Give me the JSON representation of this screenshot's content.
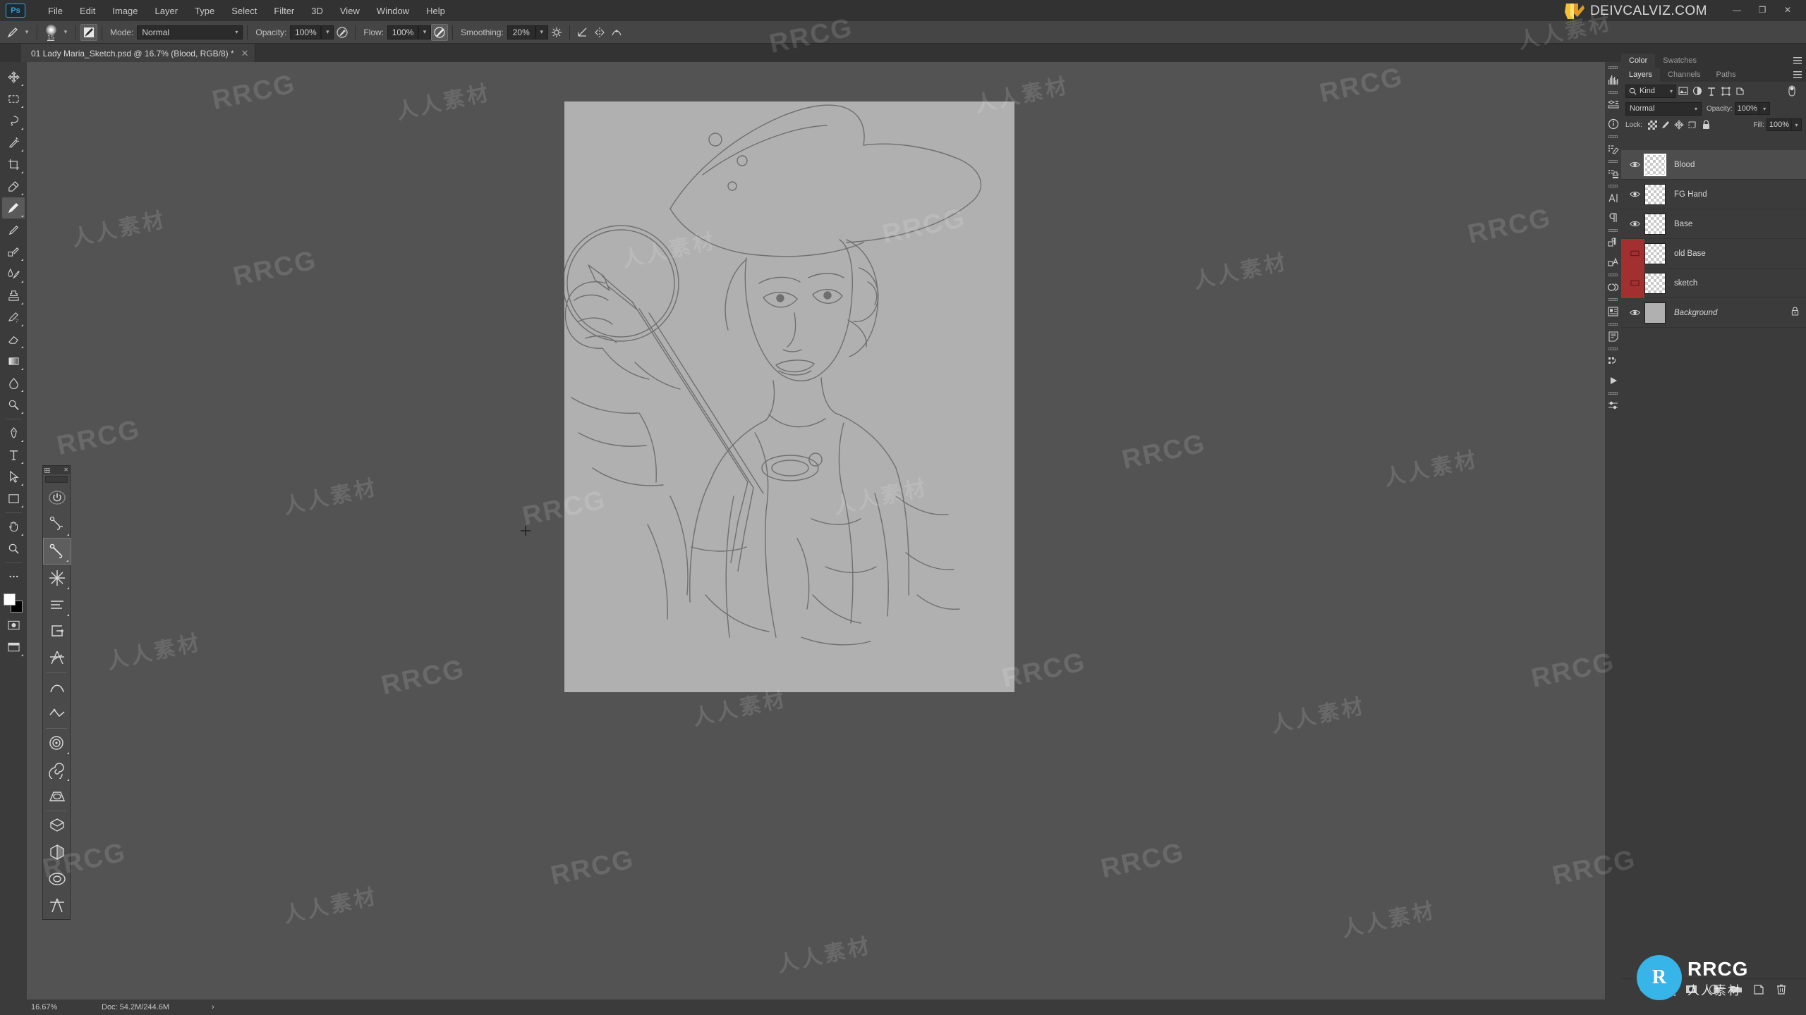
{
  "menubar": {
    "logo": "Ps",
    "items": [
      "File",
      "Edit",
      "Image",
      "Layer",
      "Type",
      "Select",
      "Filter",
      "3D",
      "View",
      "Window",
      "Help"
    ]
  },
  "brand": {
    "text": "DEIVCALVIZ.COM"
  },
  "window_controls": {
    "minimize": "—",
    "restore": "❐",
    "close": "✕"
  },
  "options_bar": {
    "brush_size": "15",
    "mode_label": "Mode:",
    "mode_value": "Normal",
    "opacity_label": "Opacity:",
    "opacity_value": "100%",
    "flow_label": "Flow:",
    "flow_value": "100%",
    "smoothing_label": "Smoothing:",
    "smoothing_value": "20%"
  },
  "document_tab": {
    "title": "01 Lady Maria_Sketch.psd @ 16.7% (Blood, RGB/8) *",
    "close": "✕"
  },
  "toolbar": {
    "tools": [
      {
        "name": "move-tool",
        "active": false
      },
      {
        "name": "marquee-tool",
        "active": false
      },
      {
        "name": "lasso-tool",
        "active": false
      },
      {
        "name": "magic-wand-tool",
        "active": false
      },
      {
        "name": "crop-tool",
        "active": false
      },
      {
        "name": "eyedropper-tool",
        "active": false
      },
      {
        "name": "brush-tool",
        "active": true
      },
      {
        "name": "pencil-tool",
        "active": false
      },
      {
        "name": "clone-stamp-tool",
        "active": false
      },
      {
        "name": "mixer-brush-tool",
        "active": false
      },
      {
        "name": "stamp-tool",
        "active": false
      },
      {
        "name": "history-brush-tool",
        "active": false
      },
      {
        "name": "eraser-tool",
        "active": false
      },
      {
        "name": "gradient-tool",
        "active": false
      },
      {
        "name": "blur-tool",
        "active": false
      },
      {
        "name": "dodge-tool",
        "active": false
      },
      {
        "name": "pen-tool",
        "active": false
      },
      {
        "name": "type-tool",
        "active": false
      },
      {
        "name": "path-select-tool",
        "active": false
      },
      {
        "name": "shape-tool",
        "active": false
      },
      {
        "name": "hand-tool",
        "active": false
      },
      {
        "name": "zoom-tool",
        "active": false
      }
    ]
  },
  "lazy_nezumi_panel": {
    "title": "",
    "close": "✕",
    "tools": [
      {
        "name": "power-toggle",
        "active": false
      },
      {
        "name": "pin-ruler",
        "active": false
      },
      {
        "name": "line-ruler",
        "active": true
      },
      {
        "name": "radial-ruler",
        "active": false
      },
      {
        "name": "parallel-ruler",
        "active": false
      },
      {
        "name": "rectangle-ruler",
        "active": false
      },
      {
        "name": "lattice-ruler",
        "active": false
      },
      {
        "name": "curve-ruler",
        "active": false
      },
      {
        "name": "polyline-ruler",
        "active": false
      },
      {
        "name": "concentric-ruler",
        "active": false
      },
      {
        "name": "spiral-ruler",
        "active": false
      },
      {
        "name": "perspective-ruler",
        "active": false
      },
      {
        "name": "box-perspective-ruler",
        "active": false
      },
      {
        "name": "vanishing-point-ruler",
        "active": false
      },
      {
        "name": "ellipse-ruler",
        "active": false
      },
      {
        "name": "symmetry-ruler",
        "active": false
      }
    ]
  },
  "icon_rail": {
    "items": [
      {
        "name": "histogram-icon"
      },
      {
        "name": "3d-panel-icon"
      },
      {
        "name": "info-icon"
      },
      {
        "name": "brush-presets-icon"
      },
      {
        "name": "clone-source-icon"
      },
      {
        "name": "character-icon"
      },
      {
        "name": "paragraph-icon"
      },
      {
        "name": "character-styles-icon"
      },
      {
        "name": "paragraph-styles-icon"
      },
      {
        "name": "creative-cloud-libraries-icon"
      },
      {
        "name": "properties-icon"
      },
      {
        "name": "notes-icon"
      },
      {
        "name": "actions-icon"
      },
      {
        "name": "timeline-icon"
      },
      {
        "name": "adjustments-icon"
      }
    ]
  },
  "dock": {
    "color_tabs": [
      {
        "label": "Color",
        "selected": true
      },
      {
        "label": "Swatches",
        "selected": false
      }
    ],
    "layer_tabs": [
      {
        "label": "Layers",
        "selected": true
      },
      {
        "label": "Channels",
        "selected": false
      },
      {
        "label": "Paths",
        "selected": false
      }
    ],
    "filter": {
      "kind_label": "Kind",
      "icons": [
        "pixel-filter-icon",
        "adjustment-filter-icon",
        "type-filter-icon",
        "shape-filter-icon",
        "smart-object-filter-icon"
      ],
      "toggle": "filter-toggle"
    },
    "blend": {
      "mode": "Normal",
      "opacity_label": "Opacity:",
      "opacity_value": "100%"
    },
    "lock": {
      "label": "Lock:",
      "icons": [
        "lock-transparency-icon",
        "lock-image-icon",
        "lock-position-icon",
        "lock-artboard-icon",
        "lock-all-icon"
      ],
      "fill_label": "Fill:",
      "fill_value": "100%"
    },
    "layers": [
      {
        "name": "Blood",
        "visible": true,
        "selected": true,
        "locked": false,
        "italic": false,
        "color": null,
        "thumb": "checker"
      },
      {
        "name": "FG Hand",
        "visible": true,
        "selected": false,
        "locked": false,
        "italic": false,
        "color": null,
        "thumb": "checker"
      },
      {
        "name": "Base",
        "visible": true,
        "selected": false,
        "locked": false,
        "italic": false,
        "color": null,
        "thumb": "checker"
      },
      {
        "name": "old Base",
        "visible": false,
        "selected": false,
        "locked": false,
        "italic": false,
        "color": "#a33030",
        "thumb": "checker"
      },
      {
        "name": "sketch",
        "visible": false,
        "selected": false,
        "locked": false,
        "italic": false,
        "color": "#a33030",
        "thumb": "checker"
      },
      {
        "name": "Background",
        "visible": true,
        "selected": false,
        "locked": true,
        "italic": true,
        "color": null,
        "thumb": "gray"
      }
    ],
    "footer_icons": [
      "link-layers-icon",
      "layer-fx-icon",
      "layer-mask-icon",
      "adjustment-layer-icon",
      "new-group-icon",
      "new-layer-icon",
      "delete-layer-icon"
    ]
  },
  "status_bar": {
    "zoom": "16.67%",
    "doc_info": "Doc: 54.2M/244.6M",
    "arrow": "›"
  },
  "watermarks": {
    "latin": "RRCG",
    "chinese": "人人素材"
  },
  "corner_badge": {
    "logo_letter": "R",
    "main": "RRCG",
    "sub": "人人素材"
  },
  "colors": {
    "accent": "#31a8e0",
    "panel_bg": "#3b3b3b",
    "canvas_bg": "#535353",
    "artboard_bg": "#b0b0b0",
    "layer_color_red": "#a33030",
    "brand_gold": "#e8b52a",
    "badge_blue": "#37b4e8"
  }
}
